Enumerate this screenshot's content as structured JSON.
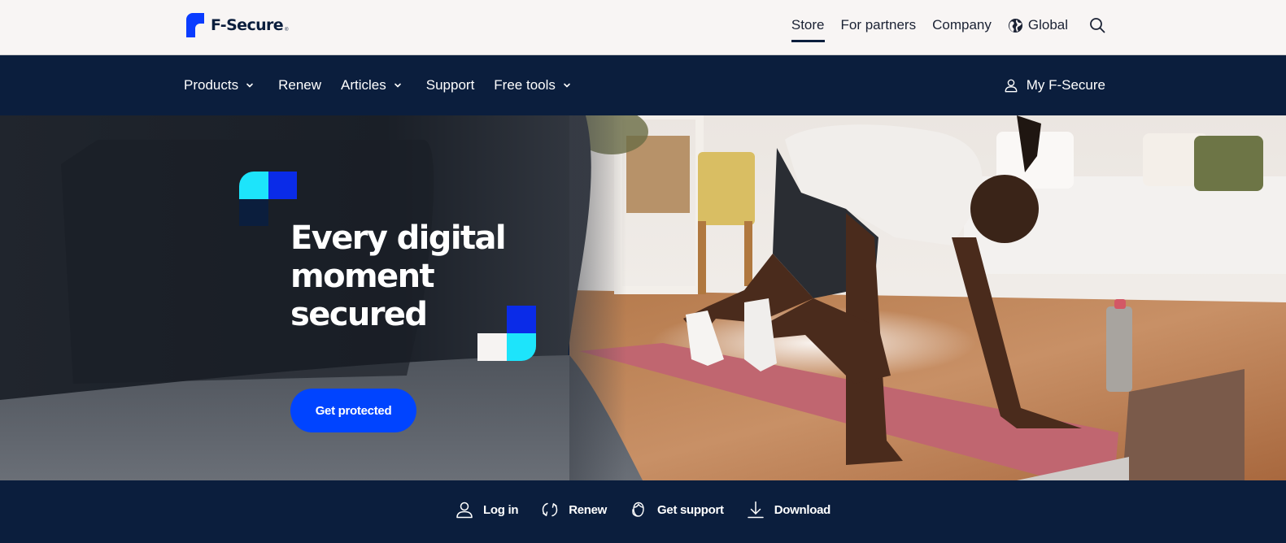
{
  "brand": {
    "name": "F-Secure",
    "registered_mark": "®",
    "colors": {
      "navy": "#0b1e3d",
      "blue": "#0044ff",
      "logo_blue": "#0a3cff",
      "cyan": "#1de4fb",
      "offwhite": "#f8f5f4"
    }
  },
  "utility_nav": {
    "items": [
      {
        "label": "Store",
        "active": true
      },
      {
        "label": "For partners",
        "active": false
      },
      {
        "label": "Company",
        "active": false
      }
    ],
    "region": {
      "label": "Global",
      "icon": "globe-icon"
    },
    "search": {
      "icon": "search-icon"
    }
  },
  "main_nav": {
    "items": [
      {
        "label": "Products",
        "has_dropdown": true
      },
      {
        "label": "Renew",
        "has_dropdown": false
      },
      {
        "label": "Articles",
        "has_dropdown": true
      },
      {
        "label": "Support",
        "has_dropdown": false
      },
      {
        "label": "Free tools",
        "has_dropdown": true
      }
    ],
    "account": {
      "label": "My F-Secure",
      "icon": "user-icon"
    }
  },
  "hero": {
    "headline_lines": [
      "Every digital",
      "moment",
      "secured"
    ],
    "cta_label": "Get protected",
    "image_description": "Man doing mountain-climber exercise on a pink yoga mat in a bright living room, with a laptop and water bottle on the wooden floor"
  },
  "quick_links": [
    {
      "label": "Log in",
      "icon": "user-icon"
    },
    {
      "label": "Renew",
      "icon": "refresh-icon"
    },
    {
      "label": "Get support",
      "icon": "headset-icon"
    },
    {
      "label": "Download",
      "icon": "download-icon"
    }
  ]
}
